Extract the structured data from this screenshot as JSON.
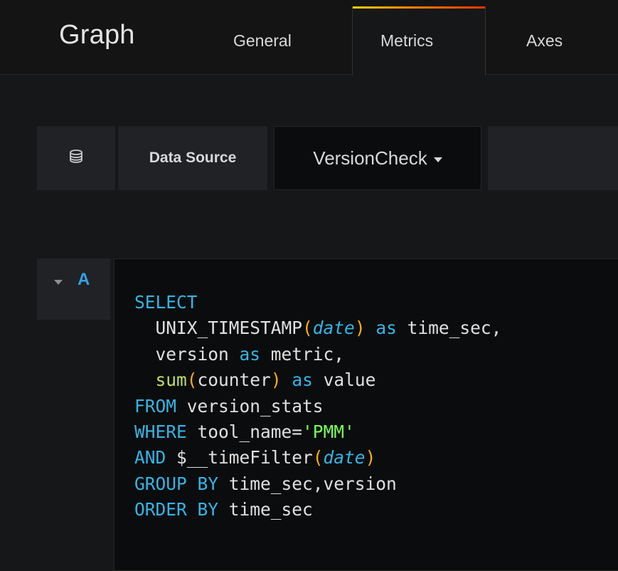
{
  "panel": {
    "title": "Graph"
  },
  "tabs": [
    {
      "label": "General"
    },
    {
      "label": "Metrics"
    },
    {
      "label": "Axes"
    }
  ],
  "active_tab": "Metrics",
  "datasource": {
    "icon": "database-icon",
    "label": "Data Source",
    "selected": "VersionCheck"
  },
  "query": {
    "ref_id": "A",
    "lines": [
      [
        {
          "t": "SELECT",
          "k": "kw"
        }
      ],
      [
        {
          "t": "  "
        },
        {
          "t": "UNIX_TIMESTAMP"
        },
        {
          "t": "(",
          "k": "paren"
        },
        {
          "t": "date",
          "k": "var"
        },
        {
          "t": ")",
          "k": "paren"
        },
        {
          "t": " "
        },
        {
          "t": "as",
          "k": "kw"
        },
        {
          "t": " time_sec,"
        }
      ],
      [
        {
          "t": "  version "
        },
        {
          "t": "as",
          "k": "kw"
        },
        {
          "t": " metric,"
        }
      ],
      [
        {
          "t": "  "
        },
        {
          "t": "sum",
          "k": "fn"
        },
        {
          "t": "(",
          "k": "paren"
        },
        {
          "t": "counter"
        },
        {
          "t": ")",
          "k": "paren"
        },
        {
          "t": " "
        },
        {
          "t": "as",
          "k": "kw"
        },
        {
          "t": " value"
        }
      ],
      [
        {
          "t": "FROM",
          "k": "kw"
        },
        {
          "t": " version_stats"
        }
      ],
      [
        {
          "t": "WHERE",
          "k": "kw"
        },
        {
          "t": " tool_name="
        },
        {
          "t": "'PMM'",
          "k": "str"
        }
      ],
      [
        {
          "t": "AND",
          "k": "kw"
        },
        {
          "t": " $__timeFilter"
        },
        {
          "t": "(",
          "k": "paren"
        },
        {
          "t": "date",
          "k": "var"
        },
        {
          "t": ")",
          "k": "paren"
        }
      ],
      [
        {
          "t": "GROUP BY",
          "k": "kw"
        },
        {
          "t": " time_sec,version"
        }
      ],
      [
        {
          "t": "ORDER BY",
          "k": "kw"
        },
        {
          "t": " time_sec"
        }
      ]
    ]
  },
  "colors": {
    "accent_gradient": [
      "#ffd000",
      "#ff7a00",
      "#ee3500"
    ],
    "keyword": "#33b5e5",
    "string": "#78ff5a",
    "paren": "#ffb000",
    "function": "#c1e066",
    "ref_id": "#33a2e5"
  }
}
